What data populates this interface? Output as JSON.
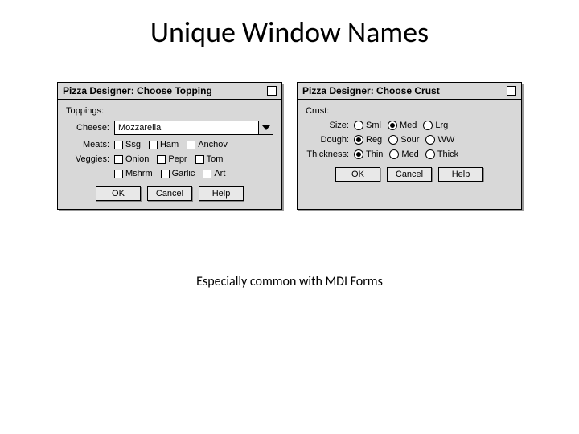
{
  "slide": {
    "title": "Unique Window Names",
    "caption": "Especially common with MDI Forms"
  },
  "topping_dialog": {
    "title": "Pizza Designer: Choose Topping",
    "group": "Toppings:",
    "cheese_label": "Cheese:",
    "cheese_value": "Mozzarella",
    "meats_label": "Meats:",
    "meats_opts": {
      "a": "Ssg",
      "b": "Ham",
      "c": "Anchov"
    },
    "veggies_label": "Veggies:",
    "veggies_opts1": {
      "a": "Onion",
      "b": "Pepr",
      "c": "Tom"
    },
    "veggies_opts2": {
      "a": "Mshrm",
      "b": "Garlic",
      "c": "Art"
    },
    "buttons": {
      "ok": "OK",
      "cancel": "Cancel",
      "help": "Help"
    }
  },
  "crust_dialog": {
    "title": "Pizza Designer: Choose Crust",
    "group": "Crust:",
    "size_label": "Size:",
    "size_opts": {
      "sml": "Sml",
      "med": "Med",
      "lrg": "Lrg"
    },
    "size_sel": "med",
    "dough_label": "Dough:",
    "dough_opts": {
      "reg": "Reg",
      "sour": "Sour",
      "ww": "WW"
    },
    "dough_sel": "reg",
    "thick_label": "Thickness:",
    "thick_opts": {
      "thin": "Thin",
      "med": "Med",
      "thick": "Thick"
    },
    "thick_sel": "thin",
    "buttons": {
      "ok": "OK",
      "cancel": "Cancel",
      "help": "Help"
    }
  }
}
